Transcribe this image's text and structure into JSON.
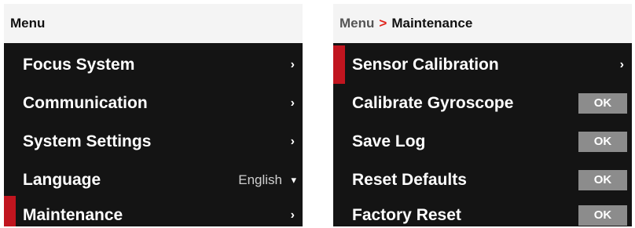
{
  "left_panel": {
    "header": "Menu",
    "items": [
      {
        "label": "Focus System",
        "chevron": "›"
      },
      {
        "label": "Communication",
        "chevron": "›"
      },
      {
        "label": "System Settings",
        "chevron": "›"
      },
      {
        "label": "Language",
        "value": "English",
        "caret": "▾"
      },
      {
        "label": "Maintenance",
        "chevron": "›",
        "selected": true
      }
    ]
  },
  "right_panel": {
    "breadcrumb": {
      "root": "Menu",
      "separator": ">",
      "current": "Maintenance"
    },
    "items": [
      {
        "label": "Sensor Calibration",
        "chevron": "›",
        "selected": true
      },
      {
        "label": "Calibrate Gyroscope",
        "button": "OK"
      },
      {
        "label": "Save Log",
        "button": "OK"
      },
      {
        "label": "Reset Defaults",
        "button": "OK"
      },
      {
        "label": "Factory Reset",
        "button": "OK"
      }
    ]
  },
  "colors": {
    "panel_bg": "#141414",
    "header_bg": "#f4f4f4",
    "selection_accent": "#c1151f",
    "breadcrumb_separator": "#e0231b",
    "ok_button_bg": "#8c8c8c"
  }
}
